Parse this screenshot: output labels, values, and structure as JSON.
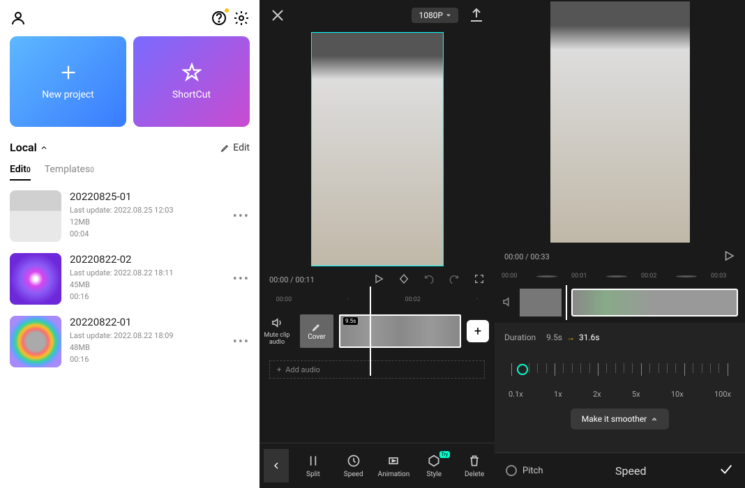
{
  "panel1": {
    "cards": {
      "new_project": "New project",
      "shortcut": "ShortCut"
    },
    "section": "Local",
    "edit": "Edit",
    "tabs": {
      "edit": "Edit",
      "edit_count": "0",
      "templates": "Templates",
      "templates_count": "0"
    },
    "projects": [
      {
        "title": "20220825-01",
        "updated": "Last update: 2022.08.25 12:03",
        "size": "12MB",
        "dur": "00:04"
      },
      {
        "title": "20220822-02",
        "updated": "Last update: 2022.08.22 18:11",
        "size": "45MB",
        "dur": "00:16"
      },
      {
        "title": "20220822-01",
        "updated": "Last update: 2022.08.22 18:09",
        "size": "48MB",
        "dur": "00:16"
      }
    ]
  },
  "panel2": {
    "resolution": "1080P",
    "time_cur": "00:00",
    "time_total": "00:11",
    "time_sep": " / ",
    "ruler": [
      "00:00",
      "00:02"
    ],
    "mute": "Mute clip audio",
    "cover": "Cover",
    "clip_time": "9.5s",
    "add_audio": "Add audio",
    "tools": {
      "split": "Split",
      "speed": "Speed",
      "animation": "Animation",
      "style": "Style",
      "delete": "Delete",
      "try": "Try"
    }
  },
  "panel3": {
    "time_cur": "00:00",
    "time_total": "00:33",
    "time_sep": " / ",
    "ruler": [
      "00:00",
      "00:01",
      "00:02",
      "00:03"
    ],
    "duration_label": "Duration",
    "duration_from": "9.5s",
    "duration_to": "31.6s",
    "speeds": [
      "0.1x",
      "1x",
      "2x",
      "5x",
      "10x",
      "100x"
    ],
    "smooth": "Make it smoother",
    "pitch": "Pitch",
    "title": "Speed"
  }
}
